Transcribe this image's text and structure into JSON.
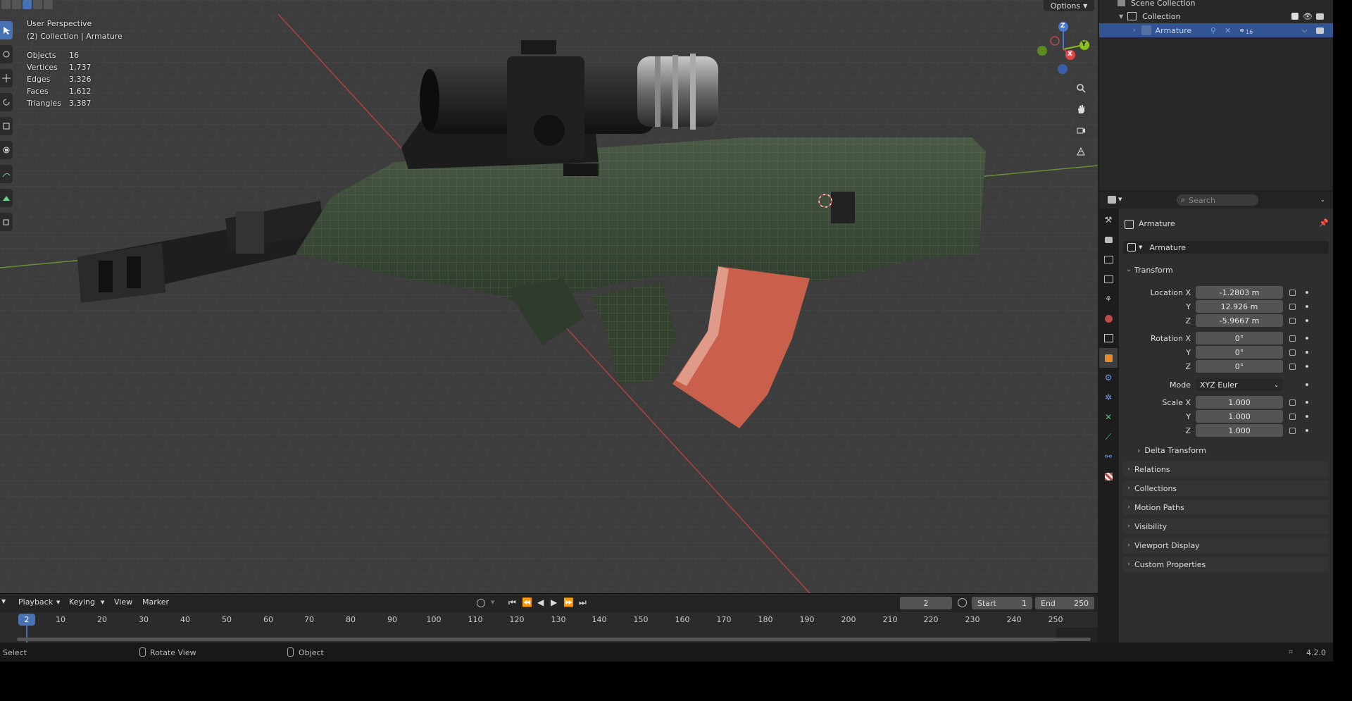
{
  "viewport": {
    "perspective": "User Perspective",
    "context": "(2) Collection | Armature",
    "options_label": "Options",
    "stats": [
      {
        "label": "Objects",
        "value": "16"
      },
      {
        "label": "Vertices",
        "value": "1,737"
      },
      {
        "label": "Edges",
        "value": "3,326"
      },
      {
        "label": "Faces",
        "value": "1,612"
      },
      {
        "label": "Triangles",
        "value": "3,387"
      }
    ],
    "gizmo": {
      "x": "X",
      "y": "Y",
      "z": "Z"
    },
    "colors": {
      "background": "#3d3d3d",
      "x_axis": "#c83a3a",
      "y_axis": "#7aa83a",
      "body": "#3a4a38",
      "magazine": "#c8604c"
    }
  },
  "timeline": {
    "menus": [
      "Playback",
      "Keying",
      "View",
      "Marker"
    ],
    "current_frame": "2",
    "start_label": "Start",
    "start_value": "1",
    "end_label": "End",
    "end_value": "250",
    "ticks": [
      "10",
      "20",
      "30",
      "40",
      "50",
      "60",
      "70",
      "80",
      "90",
      "100",
      "110",
      "120",
      "130",
      "140",
      "150",
      "160",
      "170",
      "180",
      "190",
      "200",
      "210",
      "220",
      "230",
      "240",
      "250"
    ]
  },
  "statusbar": {
    "select": "Select",
    "rotate": "Rotate View",
    "object": "Object",
    "version": "4.2.0"
  },
  "outliner": {
    "scene_collection": "Scene Collection",
    "collection": "Collection",
    "armature": "Armature",
    "armature_count": "16"
  },
  "properties": {
    "search_placeholder": "Search",
    "object_name": "Armature",
    "data_name": "Armature",
    "transform_label": "Transform",
    "location_x_label": "Location X",
    "location_x": "-1.2803 m",
    "location_y": "12.926 m",
    "location_z": "-5.9667 m",
    "rotation_x_label": "Rotation X",
    "rotation_x": "0°",
    "rotation_y": "0°",
    "rotation_z": "0°",
    "mode_label": "Mode",
    "mode_value": "XYZ Euler",
    "scale_x_label": "Scale X",
    "scale_x": "1.000",
    "scale_y": "1.000",
    "scale_z": "1.000",
    "y_label": "Y",
    "z_label": "Z",
    "delta_transform": "Delta Transform",
    "sections": [
      "Relations",
      "Collections",
      "Motion Paths",
      "Visibility",
      "Viewport Display",
      "Custom Properties"
    ]
  }
}
